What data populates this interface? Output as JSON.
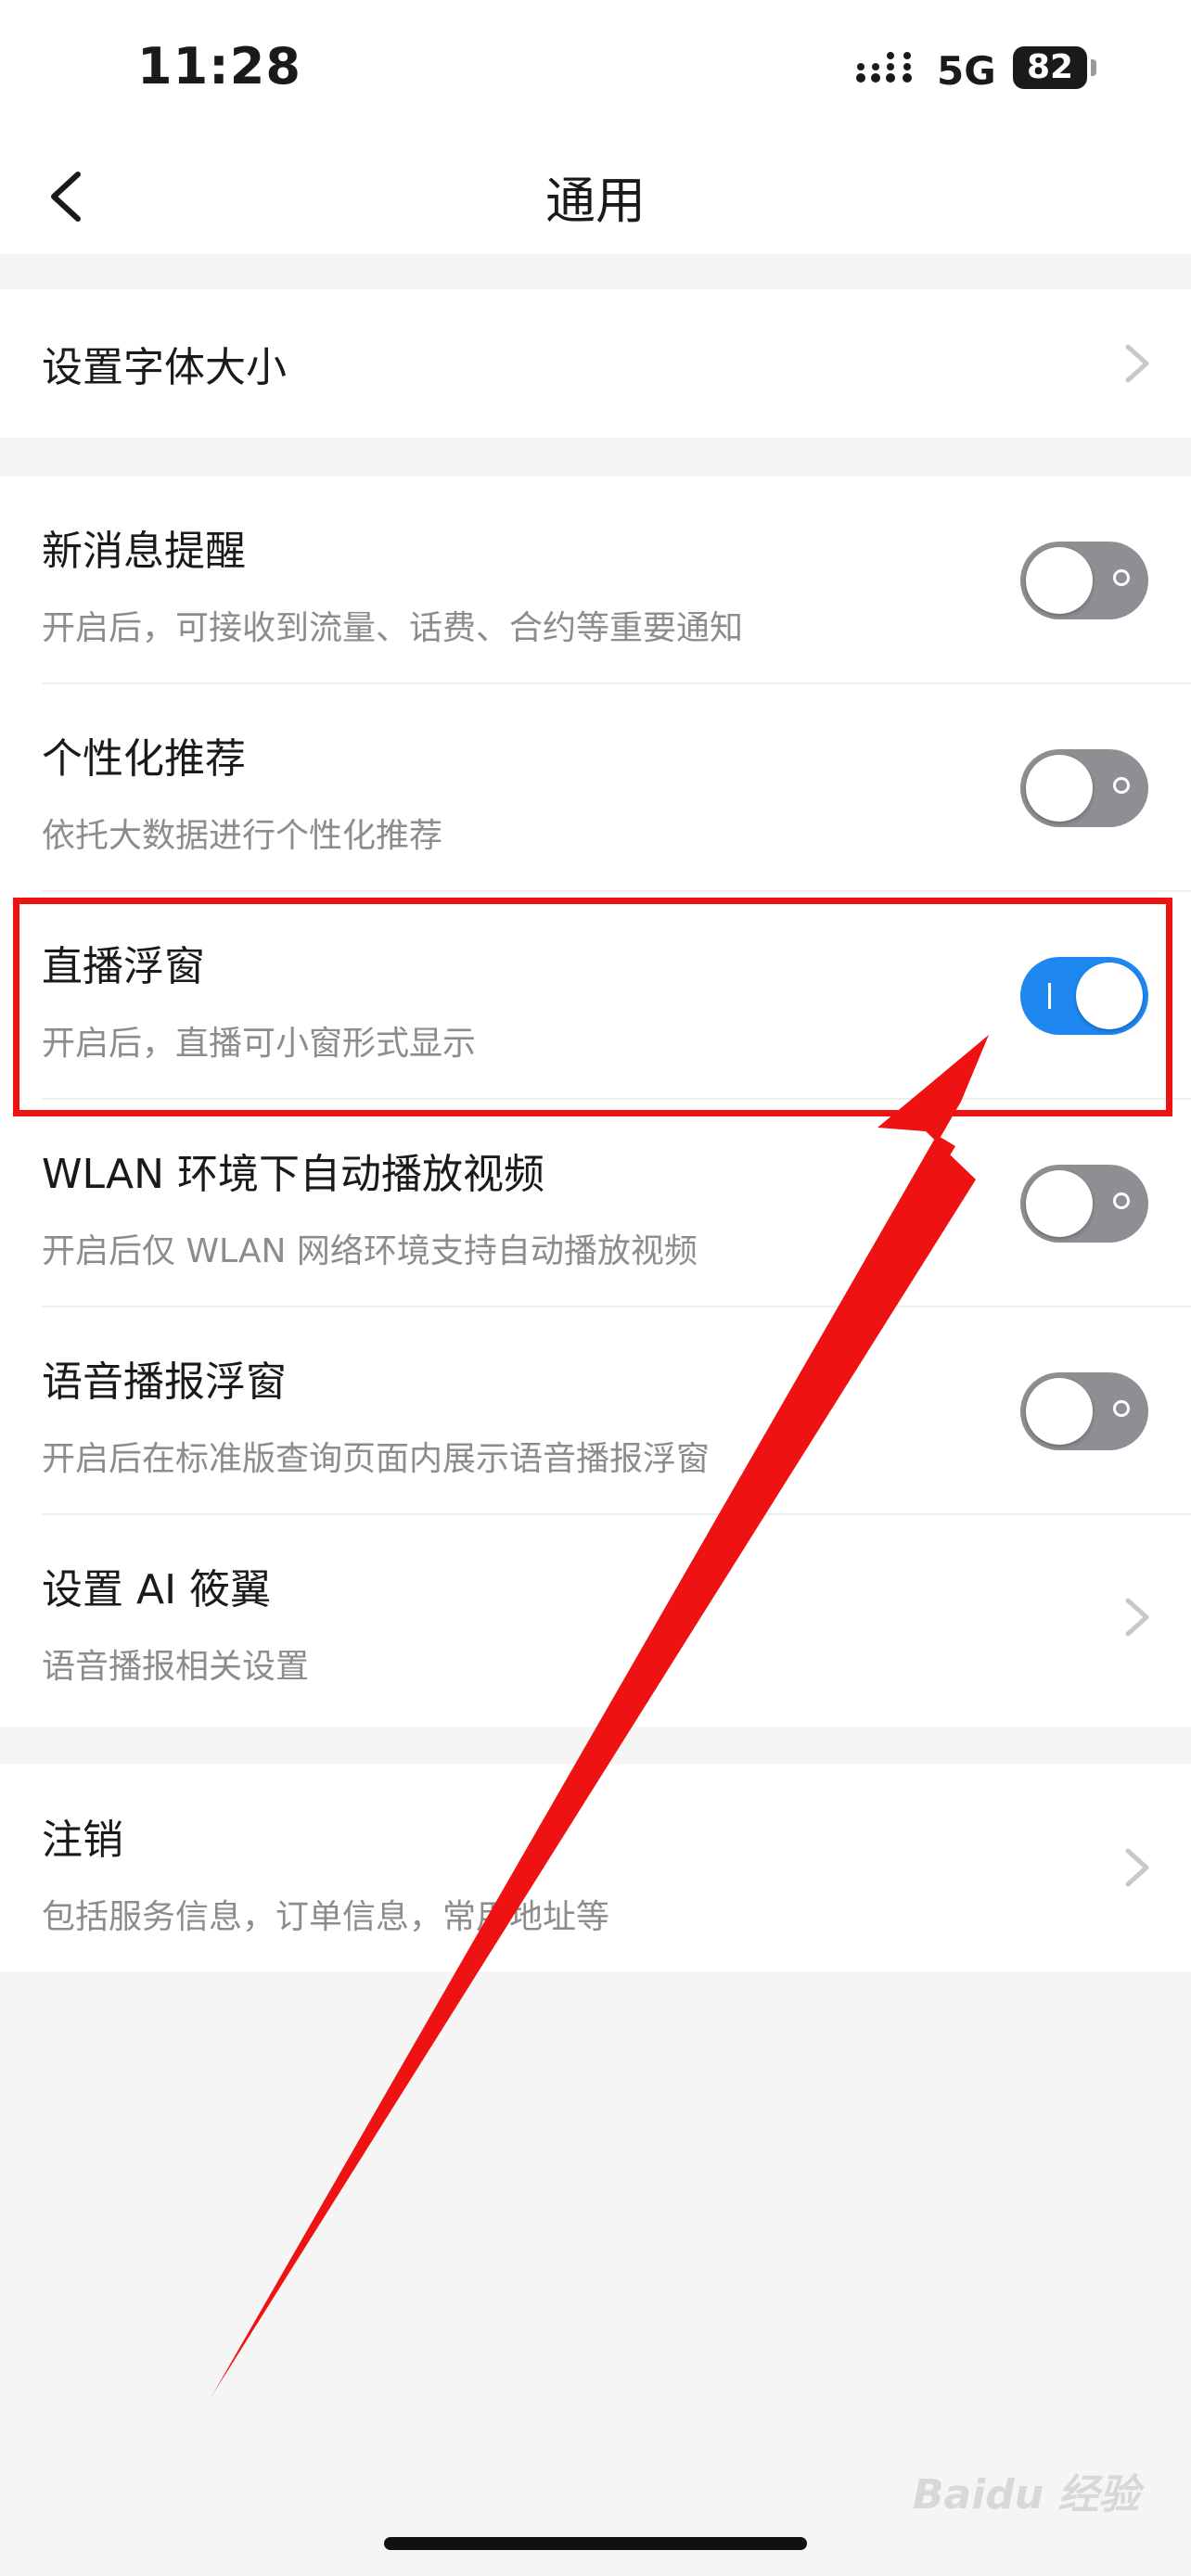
{
  "status_bar": {
    "time": "11:28",
    "network": "5G",
    "battery": "82"
  },
  "nav": {
    "title": "通用"
  },
  "sections": {
    "font_size": {
      "title": "设置字体大小"
    },
    "new_message": {
      "title": "新消息提醒",
      "subtitle": "开启后，可接收到流量、话费、合约等重要通知",
      "enabled": false
    },
    "personalized": {
      "title": "个性化推荐",
      "subtitle": "依托大数据进行个性化推荐",
      "enabled": false
    },
    "live_float": {
      "title": "直播浮窗",
      "subtitle": "开启后，直播可小窗形式显示",
      "enabled": true
    },
    "wlan_autoplay": {
      "title": "WLAN 环境下自动播放视频",
      "subtitle": "开启后仅 WLAN 网络环境支持自动播放视频",
      "enabled": false
    },
    "voice_float": {
      "title": "语音播报浮窗",
      "subtitle": "开启后在标准版查询页面内展示语音播报浮窗",
      "enabled": false
    },
    "ai": {
      "title": "设置 AI 筱翼",
      "subtitle": "语音播报相关设置"
    },
    "cancel": {
      "title": "注销",
      "subtitle": "包括服务信息，订单信息，常用地址等"
    }
  },
  "watermark": "Baidu 经验",
  "colors": {
    "toggle_on": "#1e87f0",
    "toggle_off": "#8e8e93",
    "annotation": "#ee1212"
  }
}
